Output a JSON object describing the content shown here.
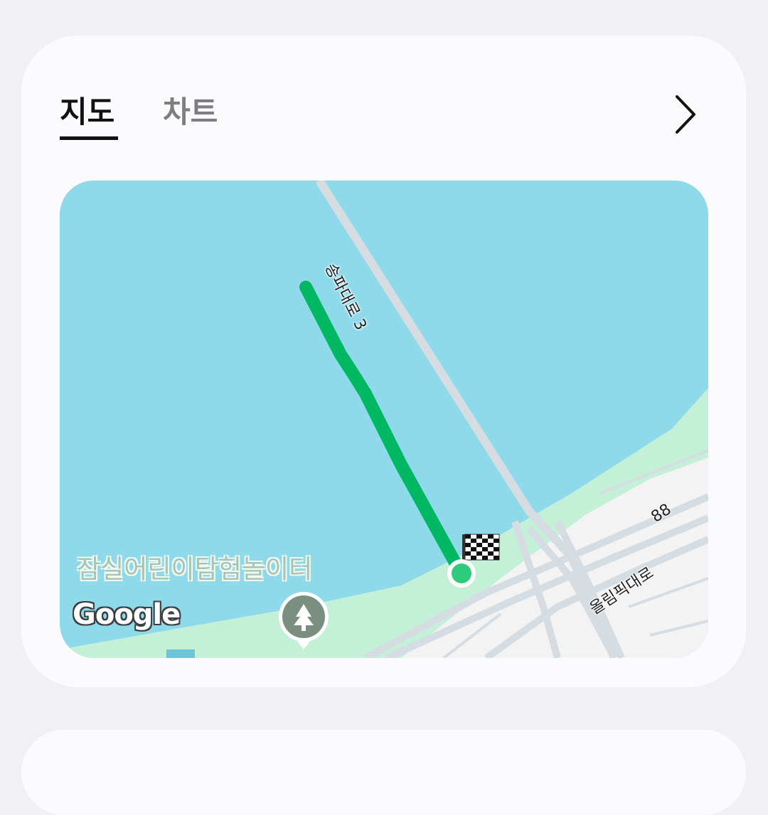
{
  "tabs": [
    {
      "label": "지도",
      "active": true
    },
    {
      "label": "차트",
      "active": false
    }
  ],
  "map": {
    "road_labels": {
      "songpa": "송파대로 3",
      "olympic": "올림픽대로",
      "route_number": "88"
    },
    "place_label": "잠실어린이탐험놀이터",
    "logo": "Google",
    "icons": {
      "park_pin": "tree-icon",
      "finish": "checkered-flag-icon",
      "start": "start-dot-icon",
      "next": "chevron-right-icon"
    },
    "colors": {
      "water": "#8fdaea",
      "land": "#c3f0d6",
      "route": "#00b862",
      "road": "#d5dde2"
    }
  }
}
